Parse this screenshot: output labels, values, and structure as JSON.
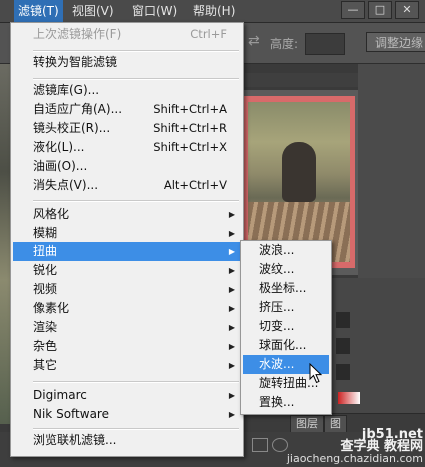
{
  "menubar": {
    "items": [
      "滤镜(T)",
      "视图(V)",
      "窗口(W)",
      "帮助(H)"
    ],
    "window_buttons": [
      "—",
      "□",
      "✕"
    ]
  },
  "options_bar": {
    "height_label": "高度:",
    "adjust_button": "调整边缘"
  },
  "filter_menu": {
    "last_filter": {
      "label": "上次滤镜操作(F)",
      "shortcut": "Ctrl+F"
    },
    "convert_smart": "转换为智能滤镜",
    "group1": [
      {
        "label": "滤镜库(G)...",
        "shortcut": ""
      },
      {
        "label": "自适应广角(A)...",
        "shortcut": "Shift+Ctrl+A"
      },
      {
        "label": "镜头校正(R)...",
        "shortcut": "Shift+Ctrl+R"
      },
      {
        "label": "液化(L)...",
        "shortcut": "Shift+Ctrl+X"
      },
      {
        "label": "油画(O)...",
        "shortcut": ""
      },
      {
        "label": "消失点(V)...",
        "shortcut": "Alt+Ctrl+V"
      }
    ],
    "group2": [
      "风格化",
      "模糊",
      "扭曲",
      "锐化",
      "视频",
      "像素化",
      "渲染",
      "杂色",
      "其它"
    ],
    "group3": [
      "Digimarc",
      "Nik Software"
    ],
    "browse_online": "浏览联机滤镜..."
  },
  "distort_submenu": {
    "items": [
      "波浪...",
      "波纹...",
      "极坐标...",
      "挤压...",
      "切变...",
      "球面化...",
      "水波...",
      "旋转扭曲...",
      "置换..."
    ],
    "selected": "水波..."
  },
  "panels": {
    "tabs": [
      "图层",
      "图"
    ]
  },
  "watermark": {
    "line1": "jb51.net",
    "line2": "查字典 教程网",
    "line3": "jiaocheng.chazidian.com"
  }
}
